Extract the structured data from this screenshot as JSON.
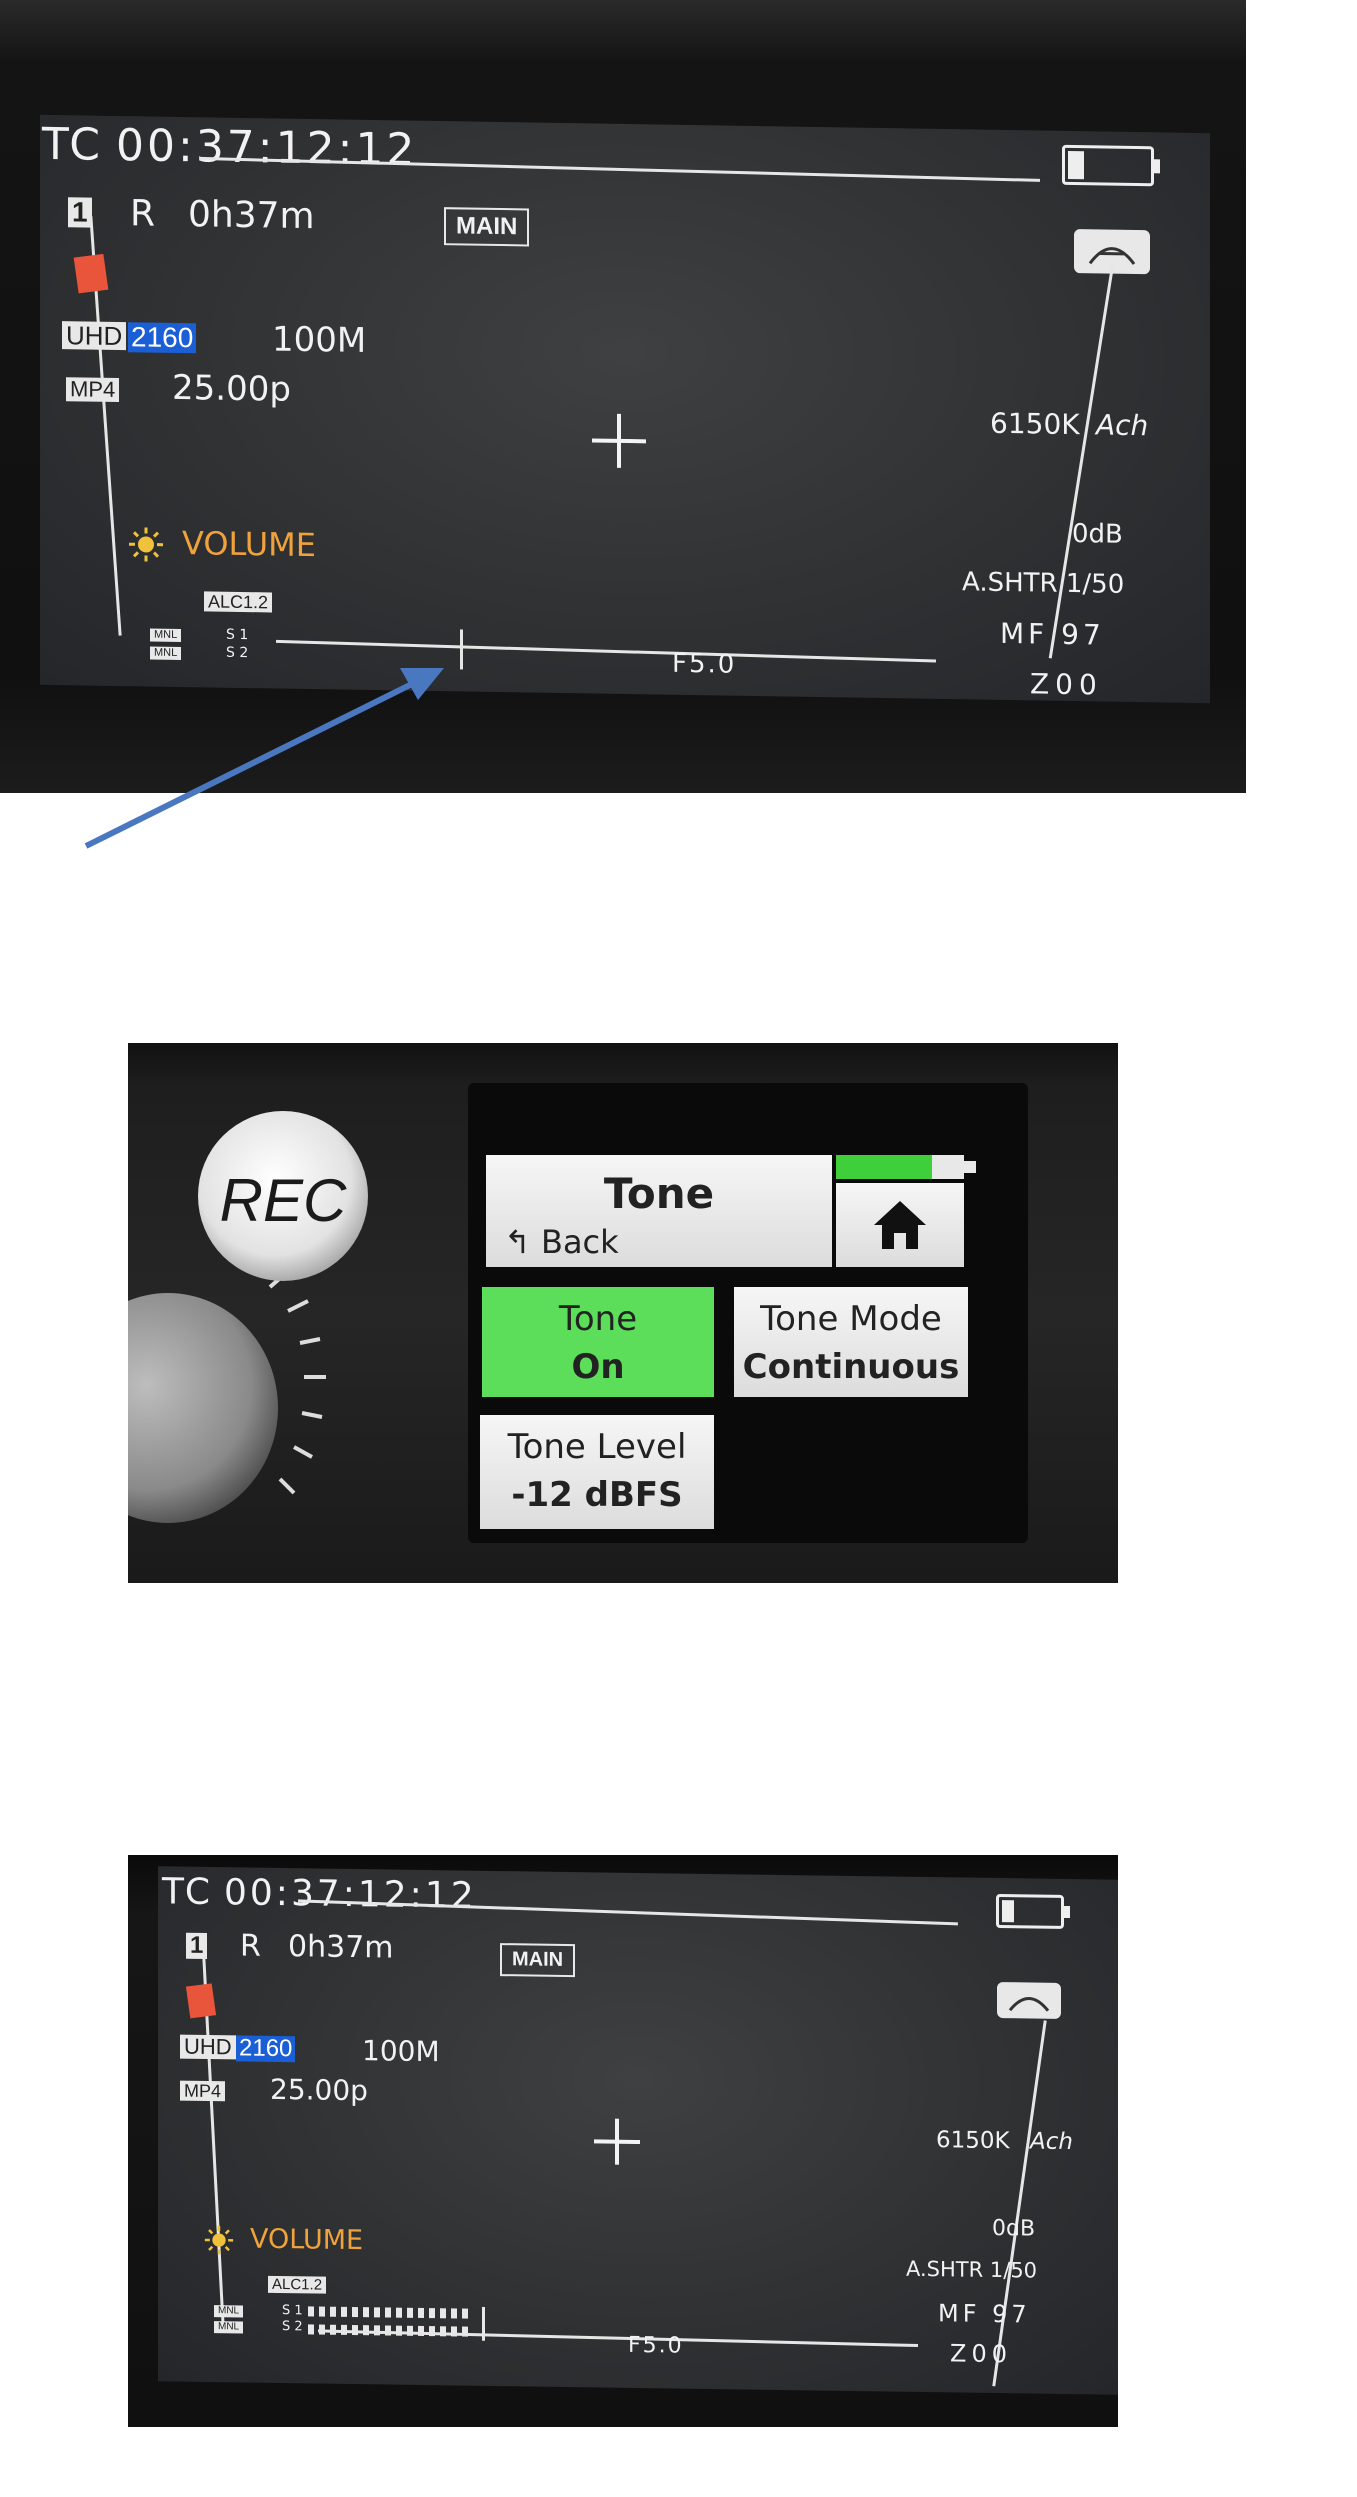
{
  "camera_screens": [
    {
      "tc_label": "TC",
      "timecode": "00:37:12:12",
      "card_slot": "1",
      "rec_status": "R",
      "remaining": "0h37m",
      "mode_badge": "MAIN",
      "resolution_uhd": "UHD",
      "resolution_2160": "2160",
      "bitrate": "100M",
      "format": "MP4",
      "framerate": "25.00p",
      "white_balance": "6150K",
      "wb_mode": "Ach",
      "gain": "0dB",
      "shutter": "A.SHTR 1/50",
      "mf": "MF 97",
      "zoom": "Z00",
      "volume_label": "VOLUME",
      "alc": "ALC1.2",
      "mnl_1": "MNL",
      "mnl_2": "MNL",
      "ch1": "S 1",
      "ch2": "S 2",
      "iris": "F5.0"
    },
    {
      "tc_label": "TC",
      "timecode": "00:37:12:12",
      "card_slot": "1",
      "rec_status": "R",
      "remaining": "0h37m",
      "mode_badge": "MAIN",
      "resolution_uhd": "UHD",
      "resolution_2160": "2160",
      "bitrate": "100M",
      "format": "MP4",
      "framerate": "25.00p",
      "white_balance": "6150K",
      "wb_mode": "Ach",
      "gain": "0dB",
      "shutter": "A.SHTR 1/50",
      "mf": "MF 97",
      "zoom": "Z00",
      "volume_label": "VOLUME",
      "alc": "ALC1.2",
      "mnl_1": "MNL",
      "mnl_2": "MNL",
      "ch1": "S 1",
      "ch2": "S 2",
      "iris": "F5.0"
    }
  ],
  "recorder": {
    "rec_button_label": "REC",
    "menu_title": "Tone",
    "back_label": "↰ Back",
    "home_icon": "home-icon",
    "battery_level": 0.75,
    "tiles": [
      {
        "label": "Tone",
        "value": "On",
        "active": true
      },
      {
        "label": "Tone Mode",
        "value": "Continuous",
        "active": false
      },
      {
        "label": "Tone Level",
        "value": "-12 dBFS",
        "active": false
      }
    ]
  },
  "annotation": {
    "arrow_color": "#4a78c0"
  },
  "colors": {
    "accent_green": "#5cde5a",
    "badge_blue": "#1a5fd6",
    "volume_orange": "#f0a23c"
  }
}
